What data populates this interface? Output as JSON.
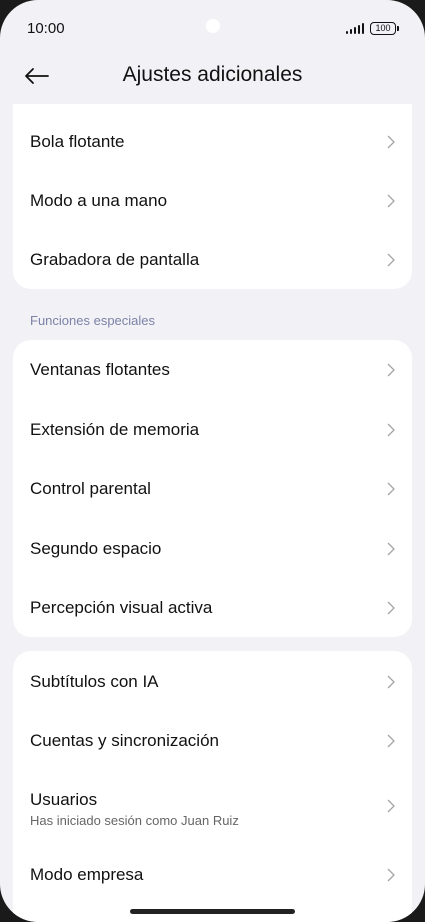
{
  "status": {
    "time": "10:00",
    "battery": "100"
  },
  "header": {
    "title": "Ajustes adicionales"
  },
  "group1": {
    "items": [
      {
        "label": "Bola flotante"
      },
      {
        "label": "Modo a una mano"
      },
      {
        "label": "Grabadora de pantalla"
      }
    ]
  },
  "section_special": {
    "label": "Funciones especiales"
  },
  "group2": {
    "items": [
      {
        "label": "Ventanas flotantes"
      },
      {
        "label": "Extensión de memoria"
      },
      {
        "label": "Control parental"
      },
      {
        "label": "Segundo espacio"
      },
      {
        "label": "Percepción visual activa"
      }
    ]
  },
  "group3": {
    "items": [
      {
        "label": "Subtítulos con IA"
      },
      {
        "label": "Cuentas y sincronización"
      },
      {
        "label": "Usuarios",
        "sub": "Has iniciado sesión como Juan Ruiz"
      },
      {
        "label": "Modo empresa"
      }
    ]
  }
}
